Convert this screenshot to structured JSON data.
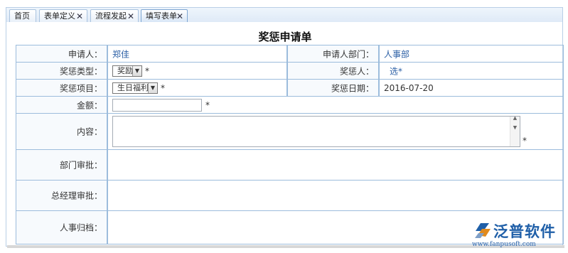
{
  "tabs": [
    {
      "label": "首页",
      "closable": false
    },
    {
      "label": "表单定义",
      "closable": true
    },
    {
      "label": "流程发起",
      "closable": true
    },
    {
      "label": "填写表单",
      "closable": true,
      "active": true
    }
  ],
  "close_glyph": "✕",
  "form": {
    "title": "奖惩申请单",
    "required_mark": "*",
    "applicant": {
      "label": "申请人：",
      "value": "郑佳"
    },
    "applicant_dept": {
      "label": "申请人部门：",
      "value": "人事部"
    },
    "reward_type": {
      "label": "奖惩类型：",
      "selected": "奖励"
    },
    "target_person": {
      "label": "奖惩人：",
      "link": "选*"
    },
    "reward_item": {
      "label": "奖惩项目：",
      "selected": "生日福利"
    },
    "reward_date": {
      "label": "奖惩日期：",
      "value": "2016-07-20"
    },
    "amount": {
      "label": "金额：",
      "value": ""
    },
    "content": {
      "label": "内容：",
      "value": ""
    },
    "dept_approval": {
      "label": "部门审批："
    },
    "gm_approval": {
      "label": "总经理审批："
    },
    "hr_archive": {
      "label": "人事归档："
    }
  },
  "watermark": {
    "brand": "泛普软件",
    "url": "www.fanpusoft.com"
  },
  "colors": {
    "accent": "#2b5fa5",
    "border": "#9cbcdc"
  }
}
